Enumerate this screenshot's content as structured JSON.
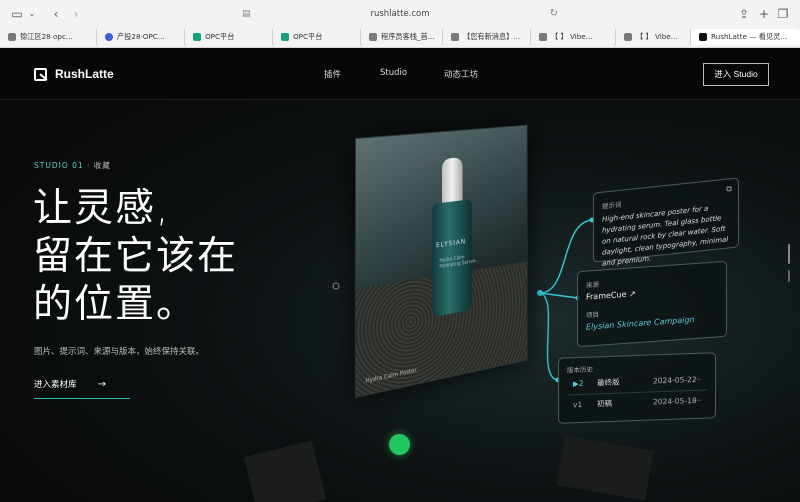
{
  "browser": {
    "url": "rushlatte.com",
    "tabs": [
      {
        "label": "锦江区28 opc...",
        "color": "#7a7a7a",
        "icon": "page-icon"
      },
      {
        "label": "产投28·OPC...",
        "color": "#3b5fd6",
        "icon": "gear-flower-icon"
      },
      {
        "label": "OPC平台",
        "color": "#18a07a",
        "icon": "28-logo-icon"
      },
      {
        "label": "OPC平台",
        "color": "#18a07a",
        "icon": "28-logo-icon"
      },
      {
        "label": "程序员客栈_首...",
        "color": "#7a7a7a",
        "icon": "page-icon"
      },
      {
        "label": "【您有新消息】...",
        "color": "#7a7a7a",
        "icon": "p-icon"
      },
      {
        "label": "【      】 Vibe...",
        "color": "#7a7a7a",
        "icon": "p-icon"
      },
      {
        "label": "【      】 Vibe...",
        "color": "#7a7a7a",
        "icon": "p-icon"
      },
      {
        "label": "RushLatte — 看见灵...",
        "color": "#111111",
        "icon": "r-logo-icon"
      }
    ]
  },
  "nav": {
    "brand": "RushLatte",
    "items": [
      "插件",
      "Studio",
      "动态工坊"
    ],
    "enter_label": "进入 Studio"
  },
  "hero": {
    "eyebrow": "STUDIO 01",
    "eyebrow_sub": " · 收藏",
    "headline_lines": [
      "让灵感,",
      "留在它该在",
      "的位置。"
    ],
    "description": "图片、提示词、来源与版本，始终保持关联。",
    "cta_label": "进入素材库",
    "cta_arrow": "→"
  },
  "poster": {
    "brand": "ELYSIAN",
    "product": "Hydra Calm",
    "product_sub": "Hydrating Serum",
    "caption": "Hydra Calm Poster"
  },
  "cards": {
    "prompt_label": "提示词",
    "prompt_text": "High-end skincare poster for a hydrating serum. Teal glass bottle on natural rock by clear water. Soft daylight, clean typography, minimal and premium.",
    "source_label": "来源",
    "source_value": "FrameCue",
    "project_label": "项目",
    "project_value": "Elysian Skincare Campaign",
    "history_label": "版本历史",
    "versions": [
      {
        "num": "▶2",
        "name": "最终版",
        "date": "2024-05-22",
        "menu": "···"
      },
      {
        "num": "v1",
        "name": "初稿",
        "date": "2024-05-18",
        "menu": "···"
      }
    ]
  },
  "colors": {
    "accent": "#2fb9a8",
    "link": "#59c9d9",
    "status_dot": "#22c55e"
  }
}
